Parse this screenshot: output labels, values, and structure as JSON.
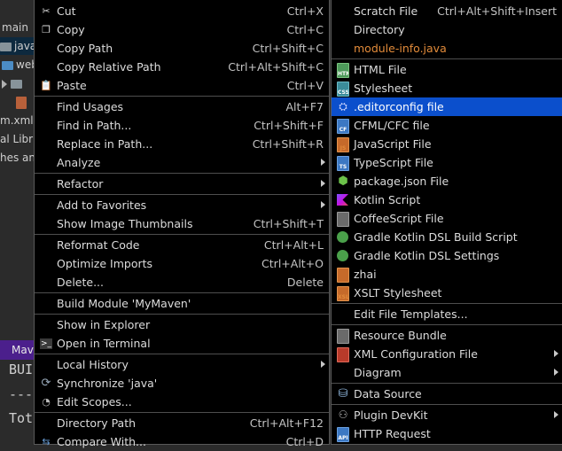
{
  "project_tree": {
    "rows": [
      {
        "label": "main"
      },
      {
        "label": "java"
      },
      {
        "label": "web"
      },
      {
        "label": ""
      },
      {
        "label": "m.xml"
      },
      {
        "label": "al Libr"
      },
      {
        "label": "hes an"
      }
    ]
  },
  "maven_tab": {
    "label": "Mav"
  },
  "console": {
    "lines": [
      "BUI",
      "---",
      "Tot"
    ]
  },
  "context_menu": {
    "items": [
      {
        "label": "Cut",
        "shortcut": "Ctrl+X",
        "icon": "scissors-icon"
      },
      {
        "label": "Copy",
        "shortcut": "Ctrl+C",
        "icon": "copy-icon"
      },
      {
        "label": "Copy Path",
        "shortcut": "Ctrl+Shift+C"
      },
      {
        "label": "Copy Relative Path",
        "shortcut": "Ctrl+Alt+Shift+C"
      },
      {
        "label": "Paste",
        "shortcut": "Ctrl+V",
        "icon": "paste-icon"
      },
      {
        "label": "Find Usages",
        "shortcut": "Alt+F7"
      },
      {
        "label": "Find in Path...",
        "shortcut": "Ctrl+Shift+F"
      },
      {
        "label": "Replace in Path...",
        "shortcut": "Ctrl+Shift+R"
      },
      {
        "label": "Analyze",
        "shortcut": ""
      },
      {
        "label": "Refactor",
        "shortcut": ""
      },
      {
        "label": "Add to Favorites",
        "shortcut": ""
      },
      {
        "label": "Show Image Thumbnails",
        "shortcut": "Ctrl+Shift+T"
      },
      {
        "label": "Reformat Code",
        "shortcut": "Ctrl+Alt+L"
      },
      {
        "label": "Optimize Imports",
        "shortcut": "Ctrl+Alt+O"
      },
      {
        "label": "Delete...",
        "shortcut": "Delete"
      },
      {
        "label": "Build Module 'MyMaven'",
        "shortcut": ""
      },
      {
        "label": "Show in Explorer",
        "shortcut": ""
      },
      {
        "label": "Open in Terminal",
        "shortcut": "",
        "icon": "terminal-icon"
      },
      {
        "label": "Local History",
        "shortcut": ""
      },
      {
        "label": "Synchronize 'java'",
        "shortcut": "",
        "icon": "sync-icon"
      },
      {
        "label": "Edit Scopes...",
        "shortcut": "",
        "icon": "scopes-icon"
      },
      {
        "label": "Directory Path",
        "shortcut": "Ctrl+Alt+F12"
      },
      {
        "label": "Compare With...",
        "shortcut": "Ctrl+D"
      }
    ]
  },
  "new_submenu": {
    "items": [
      {
        "label": "Scratch File",
        "shortcut": "Ctrl+Alt+Shift+Insert"
      },
      {
        "label": "Directory"
      },
      {
        "label": "module-info.java"
      },
      {
        "label": "HTML File"
      },
      {
        "label": "Stylesheet"
      },
      {
        "label": ".editorconfig file"
      },
      {
        "label": "CFML/CFC file"
      },
      {
        "label": "JavaScript File"
      },
      {
        "label": "TypeScript File"
      },
      {
        "label": "package.json File"
      },
      {
        "label": "Kotlin Script"
      },
      {
        "label": "CoffeeScript File"
      },
      {
        "label": "Gradle Kotlin DSL Build Script"
      },
      {
        "label": "Gradle Kotlin DSL Settings"
      },
      {
        "label": "zhai"
      },
      {
        "label": "XSLT Stylesheet"
      },
      {
        "label": "Edit File Templates..."
      },
      {
        "label": "Resource Bundle"
      },
      {
        "label": "XML Configuration File"
      },
      {
        "label": "Diagram"
      },
      {
        "label": "Data Source"
      },
      {
        "label": "Plugin DevKit"
      },
      {
        "label": "HTTP Request"
      }
    ],
    "icon_text": {
      "html": "HTML",
      "css": "CSS",
      "cf": "CF",
      "js": "JS",
      "ts": "TS",
      "xsl": "XSL",
      "api": "API"
    }
  },
  "colors": {
    "menu_bg": "#000000",
    "highlight": "#0b4fcc",
    "module_info": "#e28b3a",
    "maven_tab": "#4b1f8c"
  }
}
